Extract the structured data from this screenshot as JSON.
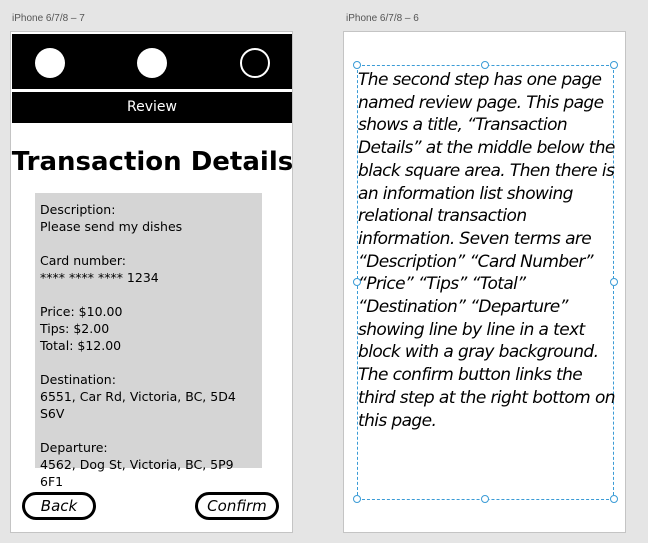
{
  "artboards": [
    {
      "label": "iPhone 6/7/8 – 7"
    },
    {
      "label": "iPhone 6/7/8 – 6"
    }
  ],
  "review_screen": {
    "header_title": "Review",
    "page_title": "Transaction Details",
    "steps": [
      {
        "state": "filled"
      },
      {
        "state": "filled"
      },
      {
        "state": "hollow"
      }
    ],
    "info": {
      "description_label": "Description:",
      "description_value": "Please send my dishes",
      "card_label": "Card number:",
      "card_value": "**** **** **** 1234",
      "price": "Price: $10.00",
      "tips": "Tips: $2.00",
      "total": "Total: $12.00",
      "destination_label": "Destination:",
      "destination_value": "6551, Car Rd, Victoria, BC, 5D4 S6V",
      "departure_label": "Departure:",
      "departure_value": "4562, Dog St, Victoria, BC, 5P9 6F1"
    },
    "buttons": {
      "back": "Back",
      "confirm": "Confirm"
    }
  },
  "description_artboard": {
    "text": "The second step has one page named review page. This page shows a title, “Transaction Details” at the middle below the black square area. Then there is an information list showing relational transaction information. Seven terms are “Description” “Card Number” “Price” “Tips” “Total” “Destination” “Departure” showing line by line in a text block with a gray background. The confirm button links the third step at the right bottom on this page."
  },
  "colors": {
    "canvas": "#e5e5e5",
    "artboard": "#ffffff",
    "header": "#000000",
    "info_block": "#d5d5d5",
    "selection": "#3a9bd6"
  }
}
